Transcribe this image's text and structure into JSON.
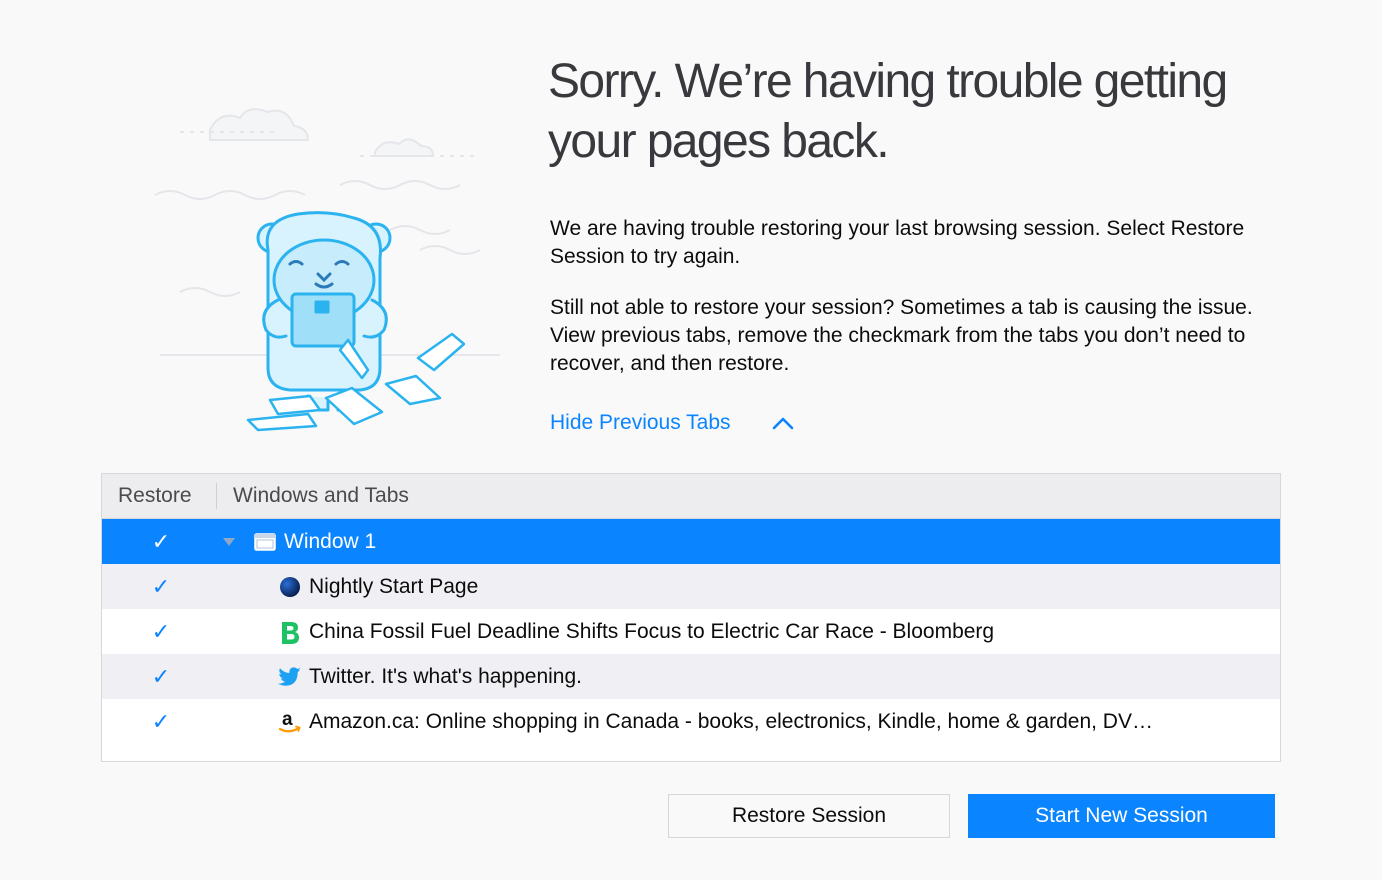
{
  "heading": {
    "title": "Sorry. We’re having trouble getting your pages back."
  },
  "body": {
    "paragraph1": "We are having trouble restoring your last browsing session. Select Restore Session to try again.",
    "paragraph2": "Still not able to restore your session? Sometimes a tab is causing the issue. View previous tabs, remove the checkmark from the tabs you don’t need to recover, and then restore."
  },
  "toggle": {
    "label": "Hide Previous Tabs",
    "icon": "chevron-up-icon"
  },
  "tree": {
    "columns": {
      "restore": "Restore",
      "tabs": "Windows and Tabs"
    },
    "window": {
      "title": "Window 1",
      "checked": true,
      "expanded": true,
      "icon": "window-icon"
    },
    "tabs": [
      {
        "title": "Nightly Start Page",
        "checked": true,
        "icon": "nightly-globe-icon"
      },
      {
        "title": "China Fossil Fuel Deadline Shifts Focus to Electric Car Race - Bloomberg",
        "checked": true,
        "icon": "bloomberg-b-icon"
      },
      {
        "title": "Twitter. It's what's happening.",
        "checked": true,
        "icon": "twitter-bird-icon"
      },
      {
        "title": "Amazon.ca: Online shopping in Canada - books, electronics, Kindle, home & garden, DV…",
        "checked": true,
        "icon": "amazon-a-icon"
      }
    ]
  },
  "buttons": {
    "restore": "Restore Session",
    "new_session": "Start New Session"
  },
  "check_glyph": "✓",
  "colors": {
    "accent": "#0a84ff",
    "illustration": "#45c9f7",
    "bloomberg": "#1ec265",
    "twitter": "#1da1f2",
    "amazon_smile": "#ff9900"
  }
}
